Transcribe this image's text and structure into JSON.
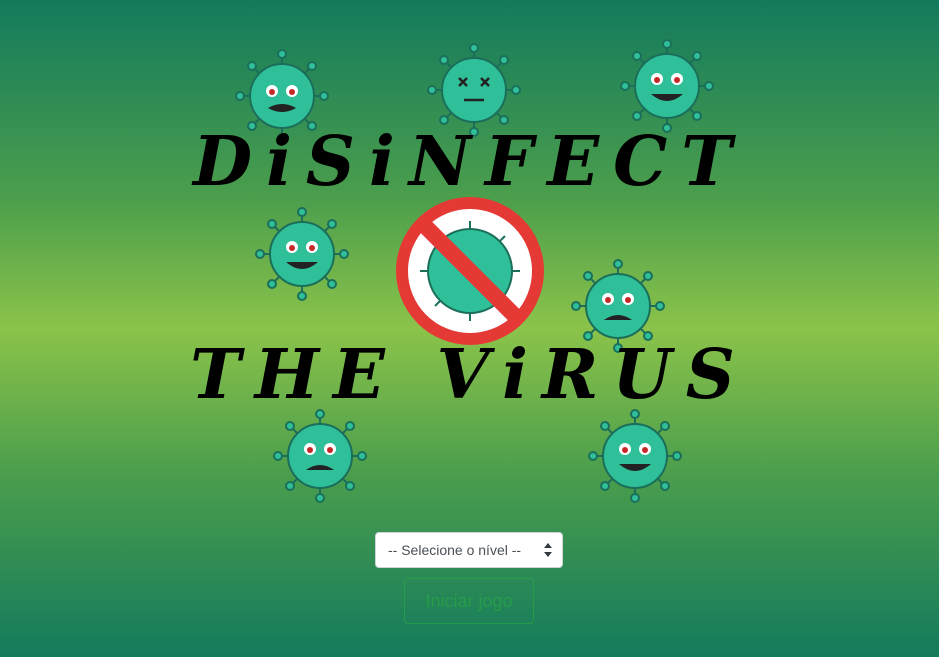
{
  "game": {
    "title_line1": "DiSiNFECT",
    "title_line2": "THE ViRUS"
  },
  "controls": {
    "level_select_placeholder": "-- Selecione o nível --",
    "start_button_label": "Iniciar jogo"
  },
  "colors": {
    "virus_body": "#2fbf99",
    "virus_outline": "#1b6f5a",
    "no_sign": "#e53935",
    "button_outline": "#28a745"
  },
  "icons": [
    "virus-icon",
    "virus-dead-icon",
    "no-virus-icon",
    "select-arrows-icon"
  ]
}
